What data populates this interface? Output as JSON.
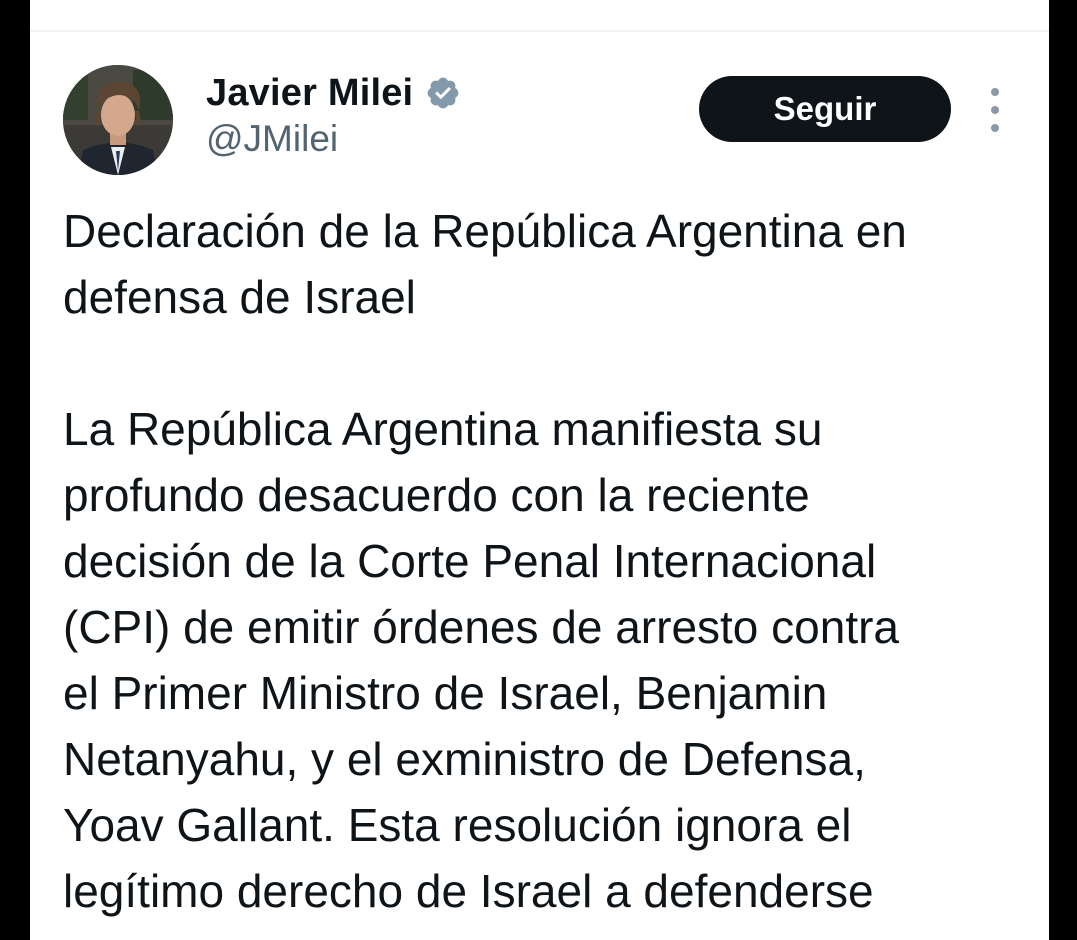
{
  "author": {
    "display_name": "Javier Milei",
    "handle": "@JMilei",
    "verified": true,
    "verified_color": "#829aab"
  },
  "actions": {
    "follow_label": "Seguir",
    "more_icon": "more-vertical-icon"
  },
  "tweet": {
    "title_lines": [
      "Declaración de la República Argentina en",
      "defensa de Israel"
    ],
    "body_lines": [
      "La República Argentina manifiesta su",
      "profundo desacuerdo con la reciente",
      "decisión de la Corte Penal Internacional",
      "(CPI) de emitir órdenes de arresto contra",
      "el Primer Ministro de Israel, Benjamin",
      "Netanyahu, y el exministro de Defensa,",
      "Yoav Gallant. Esta resolución ignora el",
      "legítimo derecho de Israel a defenderse"
    ]
  },
  "colors": {
    "text_primary": "#0f1419",
    "text_secondary": "#536471",
    "button_bg": "#0f1419",
    "button_text": "#ffffff"
  }
}
